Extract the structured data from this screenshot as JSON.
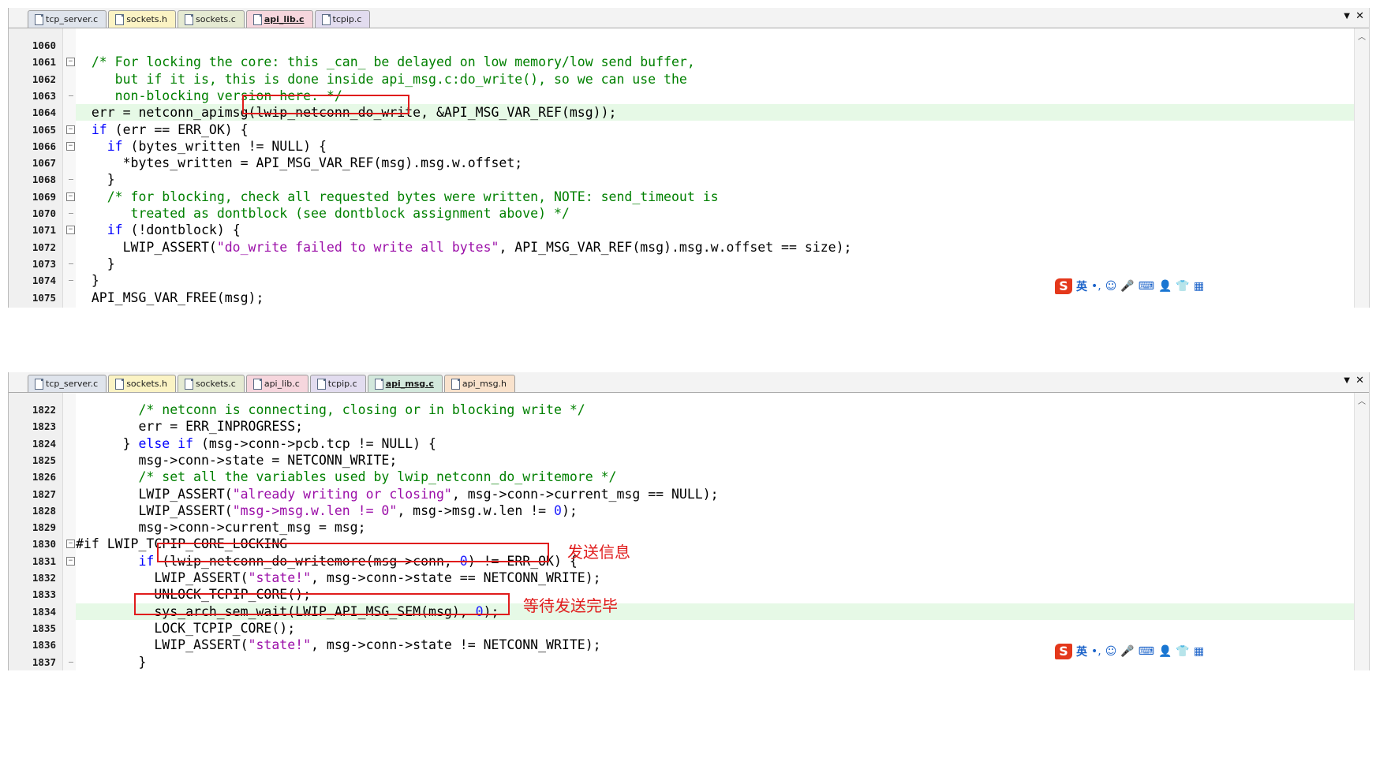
{
  "top_panel": {
    "tabs": [
      {
        "label": "tcp_server.c",
        "color": "#dfe4ec",
        "active": false
      },
      {
        "label": "sockets.h",
        "color": "#fbf3c4",
        "active": false
      },
      {
        "label": "sockets.c",
        "color": "#e5ead2",
        "active": false
      },
      {
        "label": "api_lib.c",
        "color": "#f6d6dd",
        "active": true
      },
      {
        "label": "tcpip.c",
        "color": "#e2dcef",
        "active": false
      }
    ],
    "dropdown_icon": "▼",
    "close_icon": "✕",
    "lines": [
      {
        "n": "1060",
        "fold": "",
        "hl": false,
        "tokens": []
      },
      {
        "n": "1061",
        "fold": "minus",
        "hl": false,
        "tokens": [
          {
            "t": "  "
          },
          {
            "t": "/* For locking the core: this _can_ be delayed on low memory/low send buffer,",
            "c": "c-cmt"
          }
        ]
      },
      {
        "n": "1062",
        "fold": "",
        "hl": false,
        "tokens": [
          {
            "t": "     "
          },
          {
            "t": "but if it is, this is done inside api_msg.c:do_write(), so we can use the",
            "c": "c-cmt"
          }
        ]
      },
      {
        "n": "1063",
        "fold": "end",
        "hl": false,
        "tokens": [
          {
            "t": "     "
          },
          {
            "t": "non-blocking version here. */",
            "c": "c-cmt"
          }
        ]
      },
      {
        "n": "1064",
        "fold": "",
        "hl": true,
        "tokens": [
          {
            "t": "  err = netconn_apimsg(lwip_netconn_do_write, &API_MSG_VAR_REF(msg));"
          }
        ]
      },
      {
        "n": "1065",
        "fold": "minus",
        "hl": false,
        "tokens": [
          {
            "t": "  "
          },
          {
            "t": "if",
            "c": "c-kw"
          },
          {
            "t": " (err == ERR_OK) {"
          }
        ]
      },
      {
        "n": "1066",
        "fold": "minus",
        "hl": false,
        "tokens": [
          {
            "t": "    "
          },
          {
            "t": "if",
            "c": "c-kw"
          },
          {
            "t": " (bytes_written != NULL) {"
          }
        ]
      },
      {
        "n": "1067",
        "fold": "",
        "hl": false,
        "tokens": [
          {
            "t": "      *bytes_written = API_MSG_VAR_REF(msg).msg.w.offset;"
          }
        ]
      },
      {
        "n": "1068",
        "fold": "end",
        "hl": false,
        "tokens": [
          {
            "t": "    }"
          }
        ]
      },
      {
        "n": "1069",
        "fold": "minus",
        "hl": false,
        "tokens": [
          {
            "t": "    "
          },
          {
            "t": "/* for blocking, check all requested bytes were written, NOTE: send_timeout is",
            "c": "c-cmt"
          }
        ]
      },
      {
        "n": "1070",
        "fold": "end",
        "hl": false,
        "tokens": [
          {
            "t": "       "
          },
          {
            "t": "treated as dontblock (see dontblock assignment above) */",
            "c": "c-cmt"
          }
        ]
      },
      {
        "n": "1071",
        "fold": "minus",
        "hl": false,
        "tokens": [
          {
            "t": "    "
          },
          {
            "t": "if",
            "c": "c-kw"
          },
          {
            "t": " (!dontblock) {"
          }
        ]
      },
      {
        "n": "1072",
        "fold": "",
        "hl": false,
        "tokens": [
          {
            "t": "      LWIP_ASSERT("
          },
          {
            "t": "\"do_write failed to write all bytes\"",
            "c": "c-str2"
          },
          {
            "t": ", API_MSG_VAR_REF(msg).msg.w.offset == size);"
          }
        ]
      },
      {
        "n": "1073",
        "fold": "end",
        "hl": false,
        "tokens": [
          {
            "t": "    }"
          }
        ]
      },
      {
        "n": "1074",
        "fold": "end",
        "hl": false,
        "tokens": [
          {
            "t": "  }"
          }
        ]
      },
      {
        "n": "1075",
        "fold": "",
        "hl": false,
        "tokens": [
          {
            "t": "  API_MSG_VAR_FREE(msg);"
          }
        ]
      }
    ]
  },
  "bottom_panel": {
    "tabs": [
      {
        "label": "tcp_server.c",
        "color": "#dfe4ec",
        "active": false
      },
      {
        "label": "sockets.h",
        "color": "#fbf3c4",
        "active": false
      },
      {
        "label": "sockets.c",
        "color": "#e5ead2",
        "active": false
      },
      {
        "label": "api_lib.c",
        "color": "#f6d6dd",
        "active": false
      },
      {
        "label": "tcpip.c",
        "color": "#e2dcef",
        "active": false
      },
      {
        "label": "api_msg.c",
        "color": "#d3e8dc",
        "active": true
      },
      {
        "label": "api_msg.h",
        "color": "#f9e2cc",
        "active": false
      }
    ],
    "dropdown_icon": "▼",
    "close_icon": "✕",
    "lines": [
      {
        "n": "1822",
        "fold": "",
        "hl": false,
        "tokens": [
          {
            "t": "        "
          },
          {
            "t": "/* netconn is connecting, closing or in blocking write */",
            "c": "c-cmt"
          }
        ]
      },
      {
        "n": "1823",
        "fold": "",
        "hl": false,
        "tokens": [
          {
            "t": "        err = ERR_INPROGRESS;"
          }
        ]
      },
      {
        "n": "1824",
        "fold": "",
        "hl": false,
        "tokens": [
          {
            "t": "      } "
          },
          {
            "t": "else if",
            "c": "c-kw"
          },
          {
            "t": " (msg->conn->pcb.tcp != NULL) {"
          }
        ]
      },
      {
        "n": "1825",
        "fold": "",
        "hl": false,
        "tokens": [
          {
            "t": "        msg->conn->state = NETCONN_WRITE;"
          }
        ]
      },
      {
        "n": "1826",
        "fold": "",
        "hl": false,
        "tokens": [
          {
            "t": "        "
          },
          {
            "t": "/* set all the variables used by lwip_netconn_do_writemore */",
            "c": "c-cmt"
          }
        ]
      },
      {
        "n": "1827",
        "fold": "",
        "hl": false,
        "tokens": [
          {
            "t": "        LWIP_ASSERT("
          },
          {
            "t": "\"already writing or closing\"",
            "c": "c-str2"
          },
          {
            "t": ", msg->conn->current_msg == NULL);"
          }
        ]
      },
      {
        "n": "1828",
        "fold": "",
        "hl": false,
        "tokens": [
          {
            "t": "        LWIP_ASSERT("
          },
          {
            "t": "\"msg->msg.w.len != 0\"",
            "c": "c-str2"
          },
          {
            "t": ", msg->msg.w.len != "
          },
          {
            "t": "0",
            "c": "c-num"
          },
          {
            "t": ");"
          }
        ]
      },
      {
        "n": "1829",
        "fold": "",
        "hl": false,
        "tokens": [
          {
            "t": "        msg->conn->current_msg = msg;"
          }
        ]
      },
      {
        "n": "1830",
        "fold": "minus",
        "hl": false,
        "tokens": [
          {
            "t": "#if LWIP_TCPIP_CORE_LOCKING"
          }
        ]
      },
      {
        "n": "1831",
        "fold": "minus",
        "hl": false,
        "tokens": [
          {
            "t": "        "
          },
          {
            "t": "if",
            "c": "c-kw"
          },
          {
            "t": " (lwip_netconn_do_writemore(msg->conn, "
          },
          {
            "t": "0",
            "c": "c-num"
          },
          {
            "t": ") != ERR_OK) {"
          }
        ]
      },
      {
        "n": "1832",
        "fold": "",
        "hl": false,
        "tokens": [
          {
            "t": "          LWIP_ASSERT("
          },
          {
            "t": "\"state!\"",
            "c": "c-str2"
          },
          {
            "t": ", msg->conn->state == NETCONN_WRITE);"
          }
        ]
      },
      {
        "n": "1833",
        "fold": "",
        "hl": false,
        "tokens": [
          {
            "t": "          UNLOCK_TCPIP_CORE();"
          }
        ]
      },
      {
        "n": "1834",
        "fold": "",
        "hl": true,
        "tokens": [
          {
            "t": "          sys_arch_sem_wait(LWIP_API_MSG_SEM(msg), "
          },
          {
            "t": "0",
            "c": "c-num"
          },
          {
            "t": ");"
          }
        ]
      },
      {
        "n": "1835",
        "fold": "",
        "hl": false,
        "tokens": [
          {
            "t": "          LOCK_TCPIP_CORE();"
          }
        ]
      },
      {
        "n": "1836",
        "fold": "",
        "hl": false,
        "tokens": [
          {
            "t": "          LWIP_ASSERT("
          },
          {
            "t": "\"state!\"",
            "c": "c-str2"
          },
          {
            "t": ", msg->conn->state != NETCONN_WRITE);"
          }
        ]
      },
      {
        "n": "1837",
        "fold": "end",
        "hl": false,
        "tokens": [
          {
            "t": "        }"
          }
        ]
      }
    ]
  },
  "annotations": {
    "send_info": "发送信息",
    "wait_done": "等待发送完毕"
  },
  "ime": {
    "logo": "S",
    "lang": "英",
    "icons": [
      "punctuation-icon",
      "emoji-icon",
      "microphone-icon",
      "keyboard-icon",
      "user-icon",
      "skin-icon",
      "toolbox-icon"
    ],
    "glyphs": [
      "•,",
      "☺",
      "🎤",
      "⌨",
      "👤",
      "👕",
      "▦"
    ]
  }
}
